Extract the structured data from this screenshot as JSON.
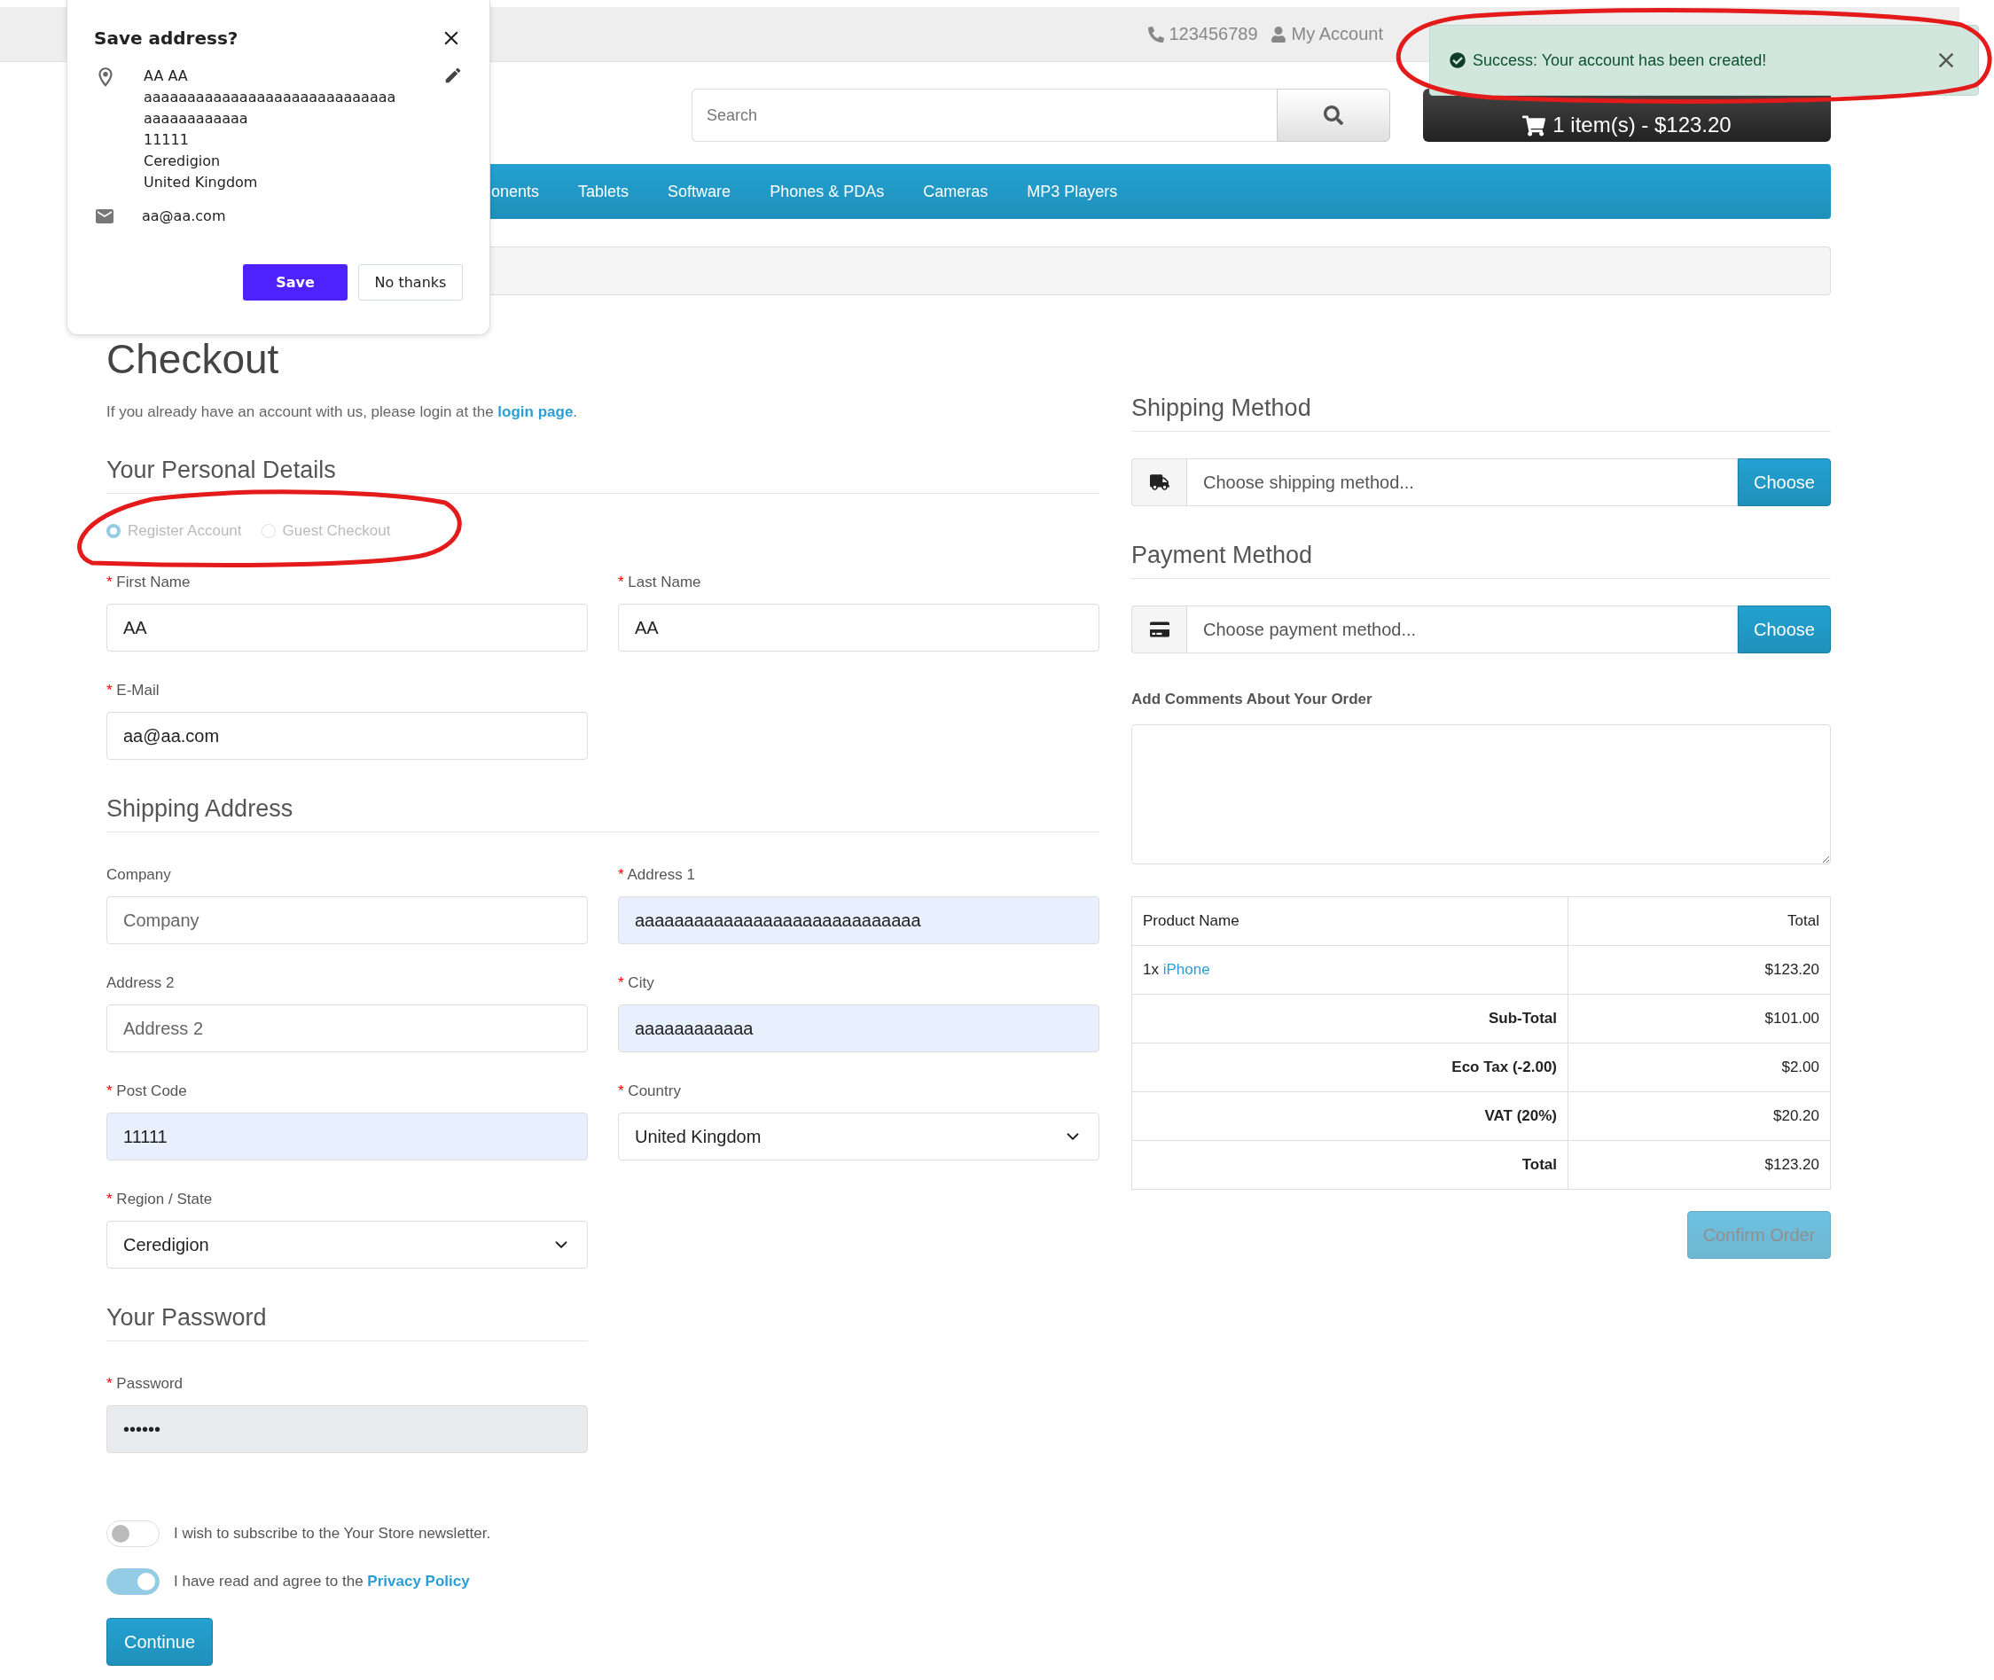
{
  "top_bar": {
    "phone": "123456789",
    "account": "My Account"
  },
  "header": {
    "search": {
      "placeholder": "Search"
    },
    "cart": "1 item(s) - $123.20"
  },
  "nav": [
    "onents",
    "Tablets",
    "Software",
    "Phones & PDAs",
    "Cameras",
    "MP3 Players"
  ],
  "page_title": "Checkout",
  "intro": {
    "text": "If you already have an account with us, please login at the",
    "link": "login page",
    "end": "."
  },
  "personal_details": {
    "title": "Your Personal Details",
    "account_options": [
      {
        "label": "Register Account",
        "selected": true,
        "disabled": true
      },
      {
        "label": "Guest Checkout",
        "selected": false,
        "disabled": true
      }
    ],
    "fields": [
      {
        "marker": "*",
        "label": "First Name",
        "kind": "text",
        "value": "AA",
        "autofilled": false,
        "disabled": false
      },
      {
        "marker": "*",
        "label": "Last Name",
        "kind": "text",
        "value": "AA",
        "autofilled": false,
        "disabled": false
      },
      {
        "marker": "*",
        "label": "E-Mail",
        "kind": "text",
        "value": "aa@aa.com",
        "autofilled": false,
        "disabled": false
      }
    ]
  },
  "shipping_address": {
    "title": "Shipping Address",
    "fields": [
      {
        "label": "Company",
        "kind": "text",
        "placeholder": "Company",
        "autofilled": false,
        "disabled": false
      },
      {
        "marker": "*",
        "label": "Address 1",
        "kind": "text",
        "value": "aaaaaaaaaaaaaaaaaaaaaaaaaaaaa",
        "autofilled": true,
        "disabled": false
      },
      {
        "label": "Address 2",
        "kind": "text",
        "placeholder": "Address 2",
        "autofilled": false,
        "disabled": false
      },
      {
        "marker": "*",
        "label": "City",
        "kind": "text",
        "value": "aaaaaaaaaaaa",
        "autofilled": true,
        "disabled": false
      },
      {
        "marker": "*",
        "label": "Post Code",
        "kind": "text",
        "value": "11111",
        "autofilled": true,
        "disabled": false
      },
      {
        "marker": "*",
        "label": "Country",
        "kind": "select",
        "value": "United Kingdom",
        "autofilled": false,
        "disabled": false
      },
      {
        "marker": "*",
        "label": "Region / State",
        "kind": "select",
        "value": "Ceredigion",
        "autofilled": false,
        "disabled": false
      }
    ]
  },
  "password": {
    "title": "Your Password",
    "fields": [
      {
        "marker": "*",
        "label": "Password",
        "kind": "text",
        "value": "••••••",
        "autofilled": false,
        "disabled": true
      }
    ]
  },
  "agreements": [
    {
      "text": "I wish to subscribe to the Your Store newsletter.",
      "on": false
    },
    {
      "text": "I have read and agree to the",
      "link": "Privacy Policy",
      "on": true
    }
  ],
  "continue_button": "Continue",
  "shipping_method": {
    "title": "Shipping Method",
    "placeholder": "Choose shipping method...",
    "button": "Choose"
  },
  "payment_method": {
    "title": "Payment Method",
    "placeholder": "Choose payment method...",
    "button": "Choose"
  },
  "comments": {
    "label": "Add Comments About Your Order"
  },
  "order_table": {
    "columns": [
      "Product Name",
      "Total"
    ],
    "products": [
      {
        "quantity": "1x",
        "name": "iPhone",
        "total": "$123.20"
      }
    ],
    "totals": [
      {
        "label": "Sub-Total",
        "value": "$101.00"
      },
      {
        "label": "Eco Tax (-2.00)",
        "value": "$2.00"
      },
      {
        "label": "VAT (20%)",
        "value": "$20.20"
      },
      {
        "label": "Total",
        "value": "$123.20"
      }
    ]
  },
  "confirm_button": "Confirm Order",
  "save_address_popup": {
    "title": "Save address?",
    "address_lines": [
      "AA AA",
      "aaaaaaaaaaaaaaaaaaaaaaaaaaaaa",
      "aaaaaaaaaaaa",
      "11111",
      "Ceredigion",
      "United Kingdom"
    ],
    "email": "aa@aa.com",
    "save": "Save",
    "dismiss": "No thanks"
  },
  "toast": {
    "message": "Success: Your account has been created!"
  }
}
